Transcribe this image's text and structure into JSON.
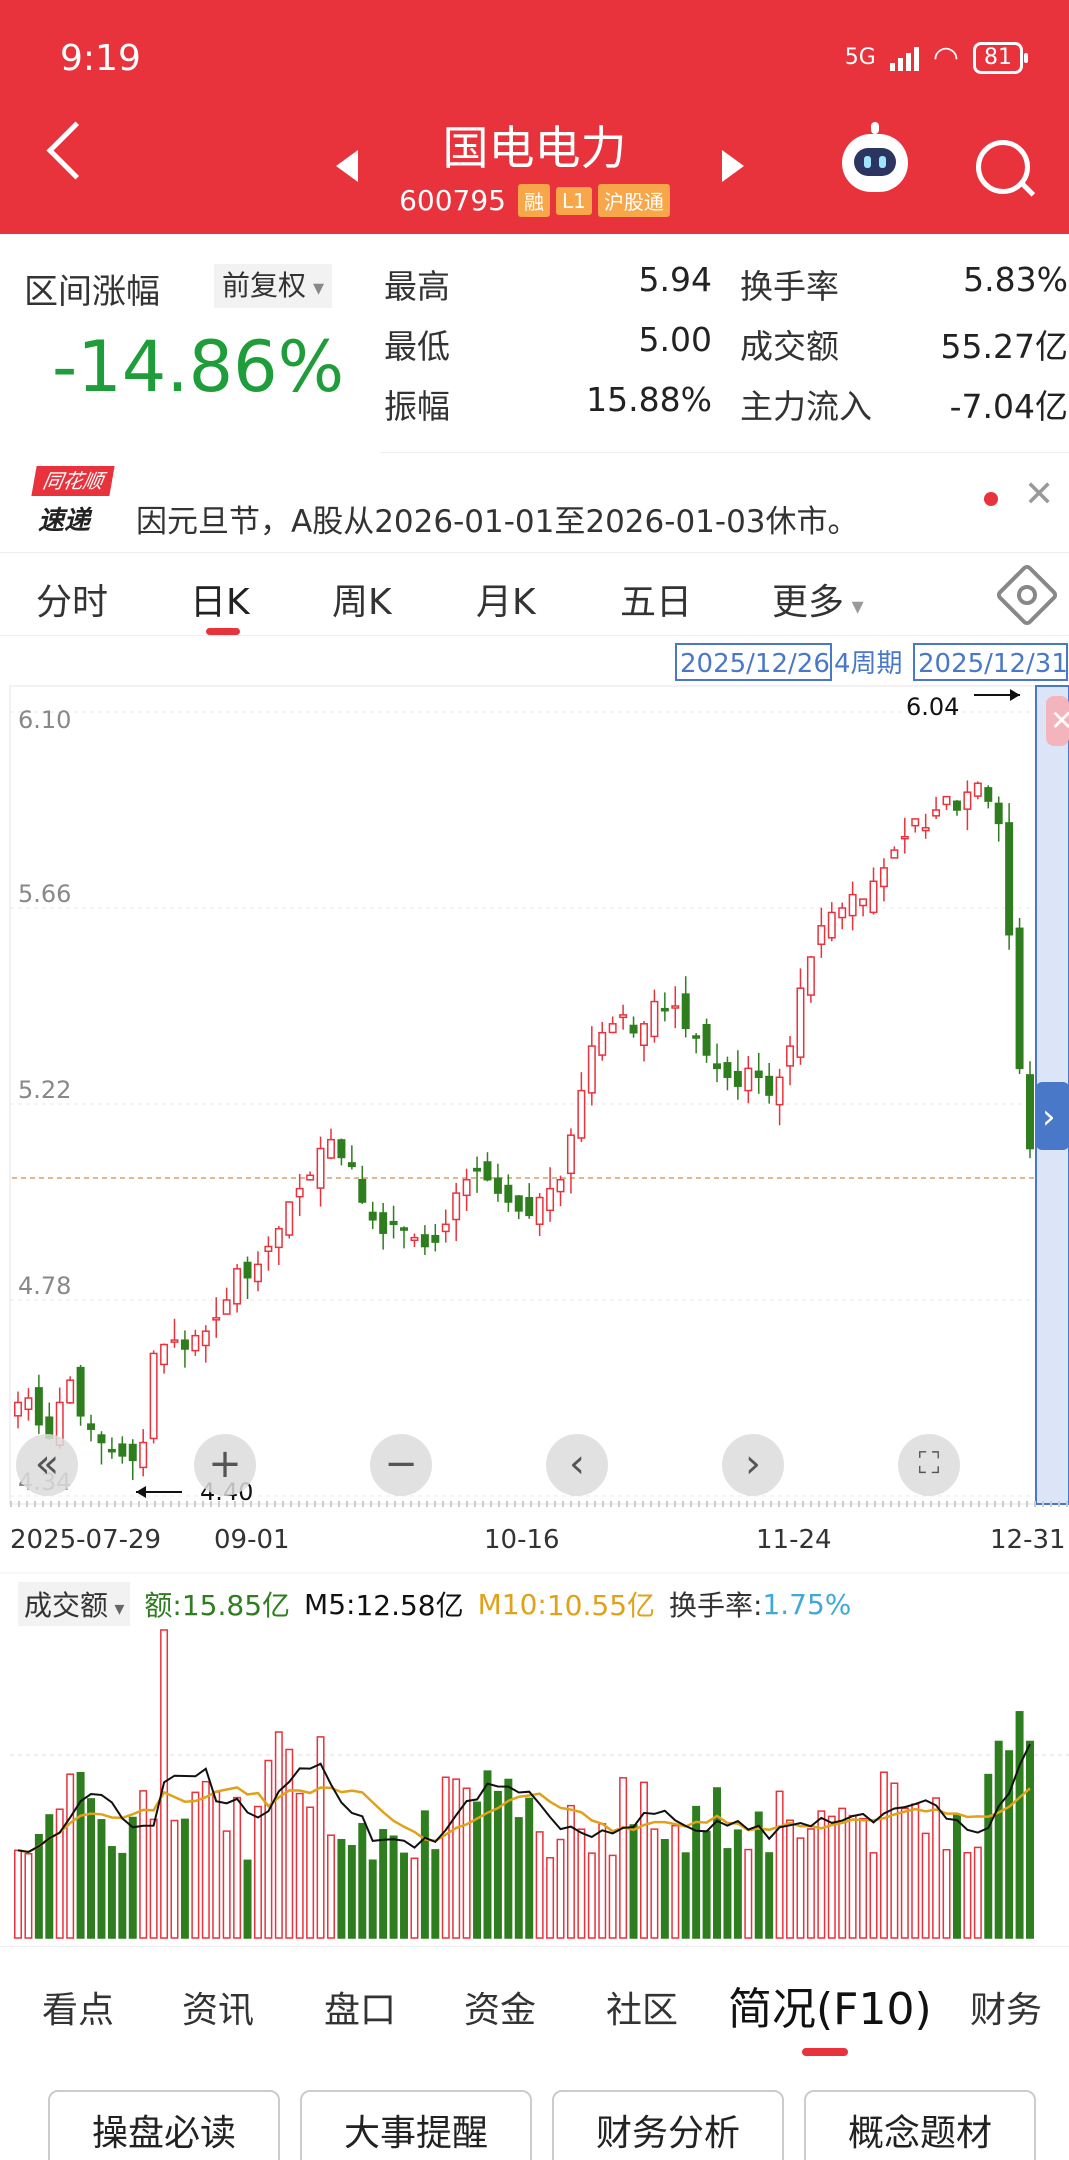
{
  "status": {
    "time": "9:19",
    "network": "5G",
    "battery": "81"
  },
  "header": {
    "title": "国电电力",
    "code": "600795",
    "tags": [
      "融",
      "L1",
      "沪股通"
    ]
  },
  "stats": {
    "range_label": "区间涨幅",
    "adjust": "前复权",
    "range_value": "-14.86%",
    "items": [
      {
        "label": "最高",
        "value": "5.94"
      },
      {
        "label": "换手率",
        "value": "5.83%"
      },
      {
        "label": "最低",
        "value": "5.00"
      },
      {
        "label": "成交额",
        "value": "55.27亿"
      },
      {
        "label": "振幅",
        "value": "15.88%"
      },
      {
        "label": "主力流入",
        "value": "-7.04亿"
      }
    ]
  },
  "notice": {
    "logo_top": "同花顺",
    "logo_bottom": "速递",
    "text": "因元旦节，A股从2026-01-01至2026-01-03休市。"
  },
  "tabs": [
    "分时",
    "日K",
    "周K",
    "月K",
    "五日",
    "更多"
  ],
  "active_tab": "日K",
  "chart": {
    "range_start": "2025/12/26",
    "range_period": "4周期",
    "range_end": "2025/12/31",
    "y_ticks": [
      "6.10",
      "5.66",
      "5.22",
      "4.78",
      "4.34"
    ],
    "x_ticks": [
      "2025-07-29",
      "09-01",
      "10-16",
      "11-24",
      "12-31"
    ],
    "high_label": "6.04",
    "low_label": "4.40",
    "controls": [
      "«",
      "+",
      "−",
      "‹",
      "›",
      "⛶"
    ]
  },
  "volume": {
    "selector": "成交额",
    "amount_label": "额:",
    "amount": "15.85亿",
    "m5_label": "M5:",
    "m5": "12.58亿",
    "m10_label": "M10:",
    "m10": "10.55亿",
    "turnover_label": "换手率:",
    "turnover": "1.75%"
  },
  "bottom_tabs": [
    "看点",
    "资讯",
    "盘口",
    "资金",
    "社区",
    "简况(F10)",
    "财务"
  ],
  "active_bottom_tab": "简况(F10)",
  "buttons": [
    "操盘必读",
    "大事提醒",
    "财务分析",
    "概念题材"
  ],
  "colors": {
    "up": "#e8323c",
    "down": "#2e7d1f",
    "m5": "#111111",
    "m10": "#e0a21a",
    "accent": "#e8323c"
  },
  "chart_data": {
    "type": "candlestick",
    "x_range": [
      "2025-07-29",
      "2025-12-31"
    ],
    "ylim": [
      4.34,
      6.1
    ],
    "high": 6.04,
    "low": 4.4,
    "close_path": [
      4.55,
      4.56,
      4.5,
      4.47,
      4.55,
      4.6,
      4.52,
      4.49,
      4.46,
      4.44,
      4.43,
      4.42,
      4.46,
      4.66,
      4.68,
      4.69,
      4.67,
      4.7,
      4.71,
      4.74,
      4.78,
      4.85,
      4.83,
      4.86,
      4.9,
      4.94,
      5.0,
      5.03,
      5.06,
      5.12,
      5.14,
      5.1,
      5.08,
      5.0,
      4.96,
      4.93,
      4.95,
      4.94,
      4.92,
      4.9,
      4.91,
      4.95,
      5.02,
      5.05,
      5.07,
      5.05,
      5.02,
      5.0,
      4.98,
      4.97,
      5.01,
      5.03,
      5.05,
      5.15,
      5.25,
      5.35,
      5.38,
      5.4,
      5.42,
      5.38,
      5.4,
      5.45,
      5.43,
      5.44,
      5.39,
      5.37,
      5.33,
      5.3,
      5.28,
      5.26,
      5.3,
      5.28,
      5.24,
      5.28,
      5.35,
      5.48,
      5.55,
      5.62,
      5.65,
      5.66,
      5.69,
      5.68,
      5.72,
      5.75,
      5.79,
      5.82,
      5.86,
      5.84,
      5.88,
      5.91,
      5.88,
      5.92,
      5.94,
      5.9,
      5.85,
      5.6,
      5.3,
      5.12
    ]
  }
}
